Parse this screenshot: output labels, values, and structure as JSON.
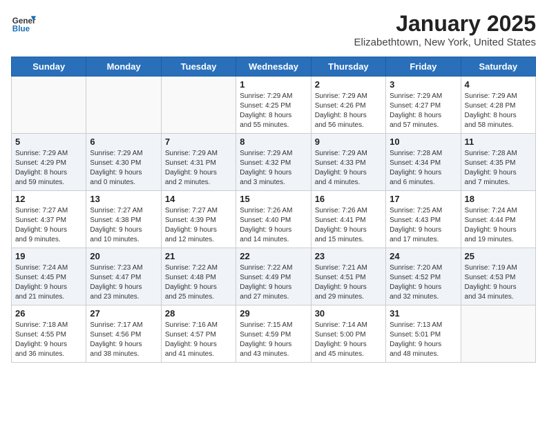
{
  "logo": {
    "general": "General",
    "blue": "Blue"
  },
  "title": "January 2025",
  "subtitle": "Elizabethtown, New York, United States",
  "weekdays": [
    "Sunday",
    "Monday",
    "Tuesday",
    "Wednesday",
    "Thursday",
    "Friday",
    "Saturday"
  ],
  "weeks": [
    [
      {
        "day": "",
        "info": ""
      },
      {
        "day": "",
        "info": ""
      },
      {
        "day": "",
        "info": ""
      },
      {
        "day": "1",
        "info": "Sunrise: 7:29 AM\nSunset: 4:25 PM\nDaylight: 8 hours\nand 55 minutes."
      },
      {
        "day": "2",
        "info": "Sunrise: 7:29 AM\nSunset: 4:26 PM\nDaylight: 8 hours\nand 56 minutes."
      },
      {
        "day": "3",
        "info": "Sunrise: 7:29 AM\nSunset: 4:27 PM\nDaylight: 8 hours\nand 57 minutes."
      },
      {
        "day": "4",
        "info": "Sunrise: 7:29 AM\nSunset: 4:28 PM\nDaylight: 8 hours\nand 58 minutes."
      }
    ],
    [
      {
        "day": "5",
        "info": "Sunrise: 7:29 AM\nSunset: 4:29 PM\nDaylight: 8 hours\nand 59 minutes."
      },
      {
        "day": "6",
        "info": "Sunrise: 7:29 AM\nSunset: 4:30 PM\nDaylight: 9 hours\nand 0 minutes."
      },
      {
        "day": "7",
        "info": "Sunrise: 7:29 AM\nSunset: 4:31 PM\nDaylight: 9 hours\nand 2 minutes."
      },
      {
        "day": "8",
        "info": "Sunrise: 7:29 AM\nSunset: 4:32 PM\nDaylight: 9 hours\nand 3 minutes."
      },
      {
        "day": "9",
        "info": "Sunrise: 7:29 AM\nSunset: 4:33 PM\nDaylight: 9 hours\nand 4 minutes."
      },
      {
        "day": "10",
        "info": "Sunrise: 7:28 AM\nSunset: 4:34 PM\nDaylight: 9 hours\nand 6 minutes."
      },
      {
        "day": "11",
        "info": "Sunrise: 7:28 AM\nSunset: 4:35 PM\nDaylight: 9 hours\nand 7 minutes."
      }
    ],
    [
      {
        "day": "12",
        "info": "Sunrise: 7:27 AM\nSunset: 4:37 PM\nDaylight: 9 hours\nand 9 minutes."
      },
      {
        "day": "13",
        "info": "Sunrise: 7:27 AM\nSunset: 4:38 PM\nDaylight: 9 hours\nand 10 minutes."
      },
      {
        "day": "14",
        "info": "Sunrise: 7:27 AM\nSunset: 4:39 PM\nDaylight: 9 hours\nand 12 minutes."
      },
      {
        "day": "15",
        "info": "Sunrise: 7:26 AM\nSunset: 4:40 PM\nDaylight: 9 hours\nand 14 minutes."
      },
      {
        "day": "16",
        "info": "Sunrise: 7:26 AM\nSunset: 4:41 PM\nDaylight: 9 hours\nand 15 minutes."
      },
      {
        "day": "17",
        "info": "Sunrise: 7:25 AM\nSunset: 4:43 PM\nDaylight: 9 hours\nand 17 minutes."
      },
      {
        "day": "18",
        "info": "Sunrise: 7:24 AM\nSunset: 4:44 PM\nDaylight: 9 hours\nand 19 minutes."
      }
    ],
    [
      {
        "day": "19",
        "info": "Sunrise: 7:24 AM\nSunset: 4:45 PM\nDaylight: 9 hours\nand 21 minutes."
      },
      {
        "day": "20",
        "info": "Sunrise: 7:23 AM\nSunset: 4:47 PM\nDaylight: 9 hours\nand 23 minutes."
      },
      {
        "day": "21",
        "info": "Sunrise: 7:22 AM\nSunset: 4:48 PM\nDaylight: 9 hours\nand 25 minutes."
      },
      {
        "day": "22",
        "info": "Sunrise: 7:22 AM\nSunset: 4:49 PM\nDaylight: 9 hours\nand 27 minutes."
      },
      {
        "day": "23",
        "info": "Sunrise: 7:21 AM\nSunset: 4:51 PM\nDaylight: 9 hours\nand 29 minutes."
      },
      {
        "day": "24",
        "info": "Sunrise: 7:20 AM\nSunset: 4:52 PM\nDaylight: 9 hours\nand 32 minutes."
      },
      {
        "day": "25",
        "info": "Sunrise: 7:19 AM\nSunset: 4:53 PM\nDaylight: 9 hours\nand 34 minutes."
      }
    ],
    [
      {
        "day": "26",
        "info": "Sunrise: 7:18 AM\nSunset: 4:55 PM\nDaylight: 9 hours\nand 36 minutes."
      },
      {
        "day": "27",
        "info": "Sunrise: 7:17 AM\nSunset: 4:56 PM\nDaylight: 9 hours\nand 38 minutes."
      },
      {
        "day": "28",
        "info": "Sunrise: 7:16 AM\nSunset: 4:57 PM\nDaylight: 9 hours\nand 41 minutes."
      },
      {
        "day": "29",
        "info": "Sunrise: 7:15 AM\nSunset: 4:59 PM\nDaylight: 9 hours\nand 43 minutes."
      },
      {
        "day": "30",
        "info": "Sunrise: 7:14 AM\nSunset: 5:00 PM\nDaylight: 9 hours\nand 45 minutes."
      },
      {
        "day": "31",
        "info": "Sunrise: 7:13 AM\nSunset: 5:01 PM\nDaylight: 9 hours\nand 48 minutes."
      },
      {
        "day": "",
        "info": ""
      }
    ]
  ]
}
